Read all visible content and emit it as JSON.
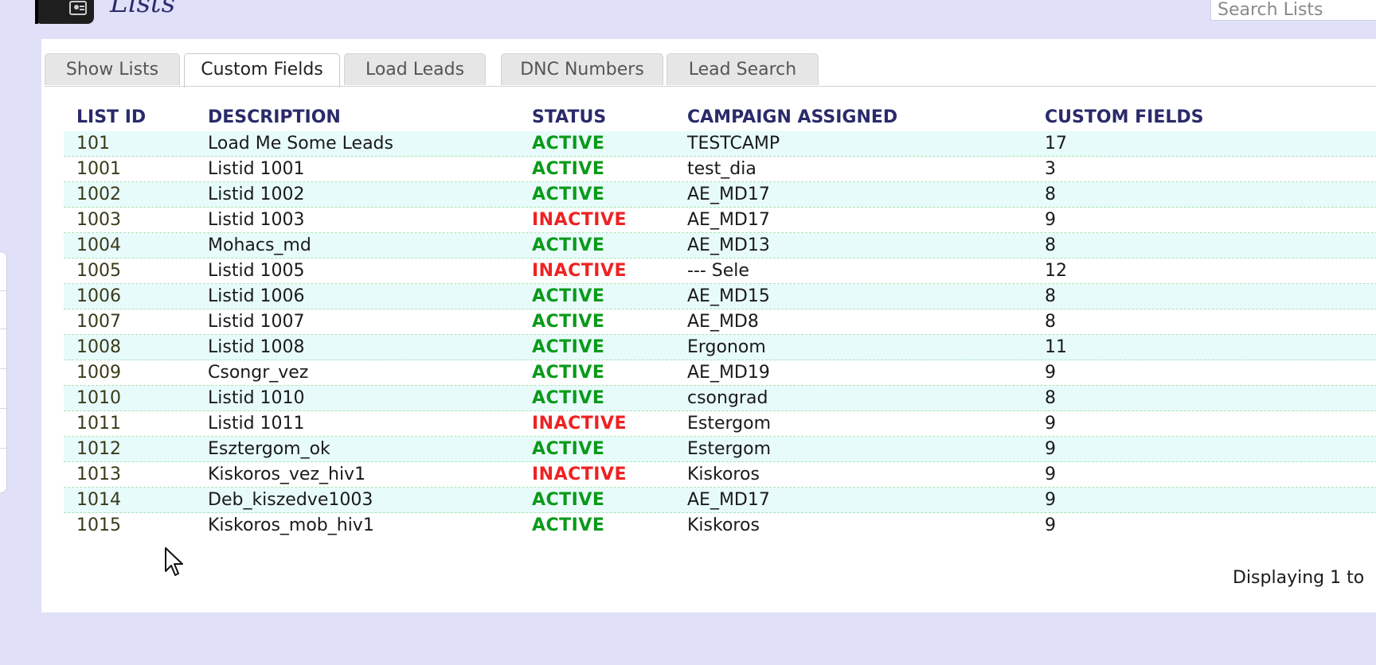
{
  "header": {
    "title": "Lists",
    "icon": "list-app-icon",
    "search_placeholder": "Search Lists"
  },
  "tabs": [
    {
      "label": "Show Lists",
      "active": false
    },
    {
      "label": "Custom Fields",
      "active": true
    },
    {
      "label": "Load Leads",
      "active": false
    },
    {
      "label": "DNC Numbers",
      "active": false
    },
    {
      "label": "Lead Search",
      "active": false
    }
  ],
  "table": {
    "columns": [
      "LIST ID",
      "DESCRIPTION",
      "STATUS",
      "CAMPAIGN ASSIGNED",
      "CUSTOM FIELDS"
    ],
    "rows": [
      {
        "id": "101",
        "description": "Load Me Some Leads",
        "status": "ACTIVE",
        "campaign": "TESTCAMP",
        "custom_fields": "17"
      },
      {
        "id": "1001",
        "description": "Listid 1001",
        "status": "ACTIVE",
        "campaign": "test_dia",
        "custom_fields": "3"
      },
      {
        "id": "1002",
        "description": "Listid 1002",
        "status": "ACTIVE",
        "campaign": "AE_MD17",
        "custom_fields": "8"
      },
      {
        "id": "1003",
        "description": "Listid 1003",
        "status": "INACTIVE",
        "campaign": "AE_MD17",
        "custom_fields": "9"
      },
      {
        "id": "1004",
        "description": "Mohacs_md",
        "status": "ACTIVE",
        "campaign": "AE_MD13",
        "custom_fields": "8"
      },
      {
        "id": "1005",
        "description": "Listid 1005",
        "status": "INACTIVE",
        "campaign": "--- Sele",
        "custom_fields": "12"
      },
      {
        "id": "1006",
        "description": "Listid 1006",
        "status": "ACTIVE",
        "campaign": "AE_MD15",
        "custom_fields": "8"
      },
      {
        "id": "1007",
        "description": "Listid 1007",
        "status": "ACTIVE",
        "campaign": "AE_MD8",
        "custom_fields": "8"
      },
      {
        "id": "1008",
        "description": "Listid 1008",
        "status": "ACTIVE",
        "campaign": "Ergonom",
        "custom_fields": "11"
      },
      {
        "id": "1009",
        "description": "Csongr_vez",
        "status": "ACTIVE",
        "campaign": "AE_MD19",
        "custom_fields": "9"
      },
      {
        "id": "1010",
        "description": "Listid 1010",
        "status": "ACTIVE",
        "campaign": "csongrad",
        "custom_fields": "8"
      },
      {
        "id": "1011",
        "description": "Listid 1011",
        "status": "INACTIVE",
        "campaign": "Estergom",
        "custom_fields": "9"
      },
      {
        "id": "1012",
        "description": "Esztergom_ok",
        "status": "ACTIVE",
        "campaign": "Estergom",
        "custom_fields": "9"
      },
      {
        "id": "1013",
        "description": "Kiskoros_vez_hiv1",
        "status": "INACTIVE",
        "campaign": "Kiskoros",
        "custom_fields": "9"
      },
      {
        "id": "1014",
        "description": "Deb_kiszedve1003",
        "status": "ACTIVE",
        "campaign": "AE_MD17",
        "custom_fields": "9"
      },
      {
        "id": "1015",
        "description": "Kiskoros_mob_hiv1",
        "status": "ACTIVE",
        "campaign": "Kiskoros",
        "custom_fields": "9"
      }
    ]
  },
  "footer": {
    "pagination_text": "Displaying 1 to"
  },
  "colors": {
    "background": "#e0e0f8",
    "active": "#0a9a1a",
    "inactive": "#ee2222",
    "header_text": "#2a2a6a",
    "row_alt": "#e8fbfb"
  }
}
